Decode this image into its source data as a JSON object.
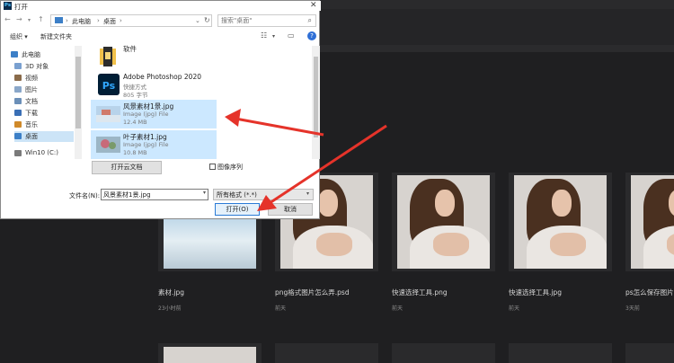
{
  "dialog": {
    "title": "打开",
    "app_badge": "Ps",
    "breadcrumb": [
      "此电脑",
      "桌面"
    ],
    "search_placeholder": "搜索\"桌面\"",
    "toolbar": {
      "organize": "组织 ▾",
      "new_folder": "新建文件夹"
    },
    "nav_items": [
      {
        "label": "此电脑",
        "color": "#3c7fc7"
      },
      {
        "label": "3D 对象",
        "color": "#7aa0d0"
      },
      {
        "label": "视频",
        "color": "#8a6b4a"
      },
      {
        "label": "图片",
        "color": "#8aa7c9"
      },
      {
        "label": "文档",
        "color": "#6b8fb8"
      },
      {
        "label": "下载",
        "color": "#3a6fb5"
      },
      {
        "label": "音乐",
        "color": "#d08a2a"
      },
      {
        "label": "桌面",
        "color": "#3c7fc7"
      },
      {
        "label": "Win10 (C:)",
        "color": "#7a7a7a"
      }
    ],
    "files": [
      {
        "name": "软件",
        "type": "",
        "size": ""
      },
      {
        "name": "Adobe Photoshop 2020",
        "type": "快捷方式",
        "size": "805 字节"
      },
      {
        "name": "风景素材1景.jpg",
        "type": "Image (jpg) File",
        "size": "12.4 MB"
      },
      {
        "name": "叶子素材1.jpg",
        "type": "Image (jpg) File",
        "size": "10.8 MB"
      }
    ],
    "cloud_button": "打开云文档",
    "preview_checkbox": "图像序列",
    "filename_label": "文件名(N):",
    "filename_value": "风景素材1景.jpg",
    "filetype_value": "所有格式 (*.*)",
    "open_button": "打开(O)",
    "cancel_button": "取消"
  },
  "background": {
    "cards": [
      {
        "title": "素材.jpg",
        "time": "23小时前"
      },
      {
        "title": "png格式图片怎么弄.psd",
        "time": "前天"
      },
      {
        "title": "快速选择工具.png",
        "time": "前天"
      },
      {
        "title": "快速选择工具.jpg",
        "time": "前天"
      },
      {
        "title": "ps怎么保存图片",
        "time": "3天前"
      }
    ]
  },
  "annotation_color": "#e5332a"
}
